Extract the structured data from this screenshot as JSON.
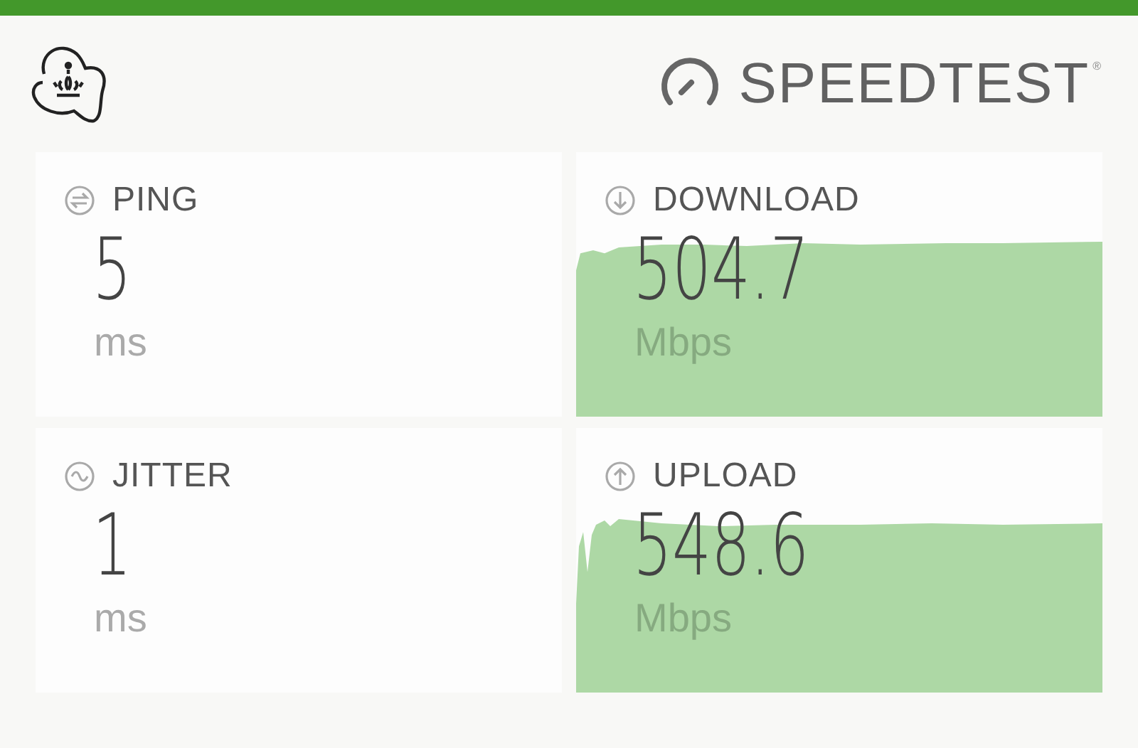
{
  "header": {
    "brand": "SPEEDTEST",
    "trademark": "®"
  },
  "metrics": [
    {
      "kind": "plain",
      "label": "PING",
      "value": "5",
      "unit": "ms"
    },
    {
      "kind": "graph",
      "label": "DOWNLOAD",
      "value": "504.7",
      "unit": "Mbps"
    },
    {
      "kind": "plain",
      "label": "JITTER",
      "value": "1",
      "unit": "ms"
    },
    {
      "kind": "graph",
      "label": "UPLOAD",
      "value": "548.6",
      "unit": "Mbps"
    }
  ]
}
